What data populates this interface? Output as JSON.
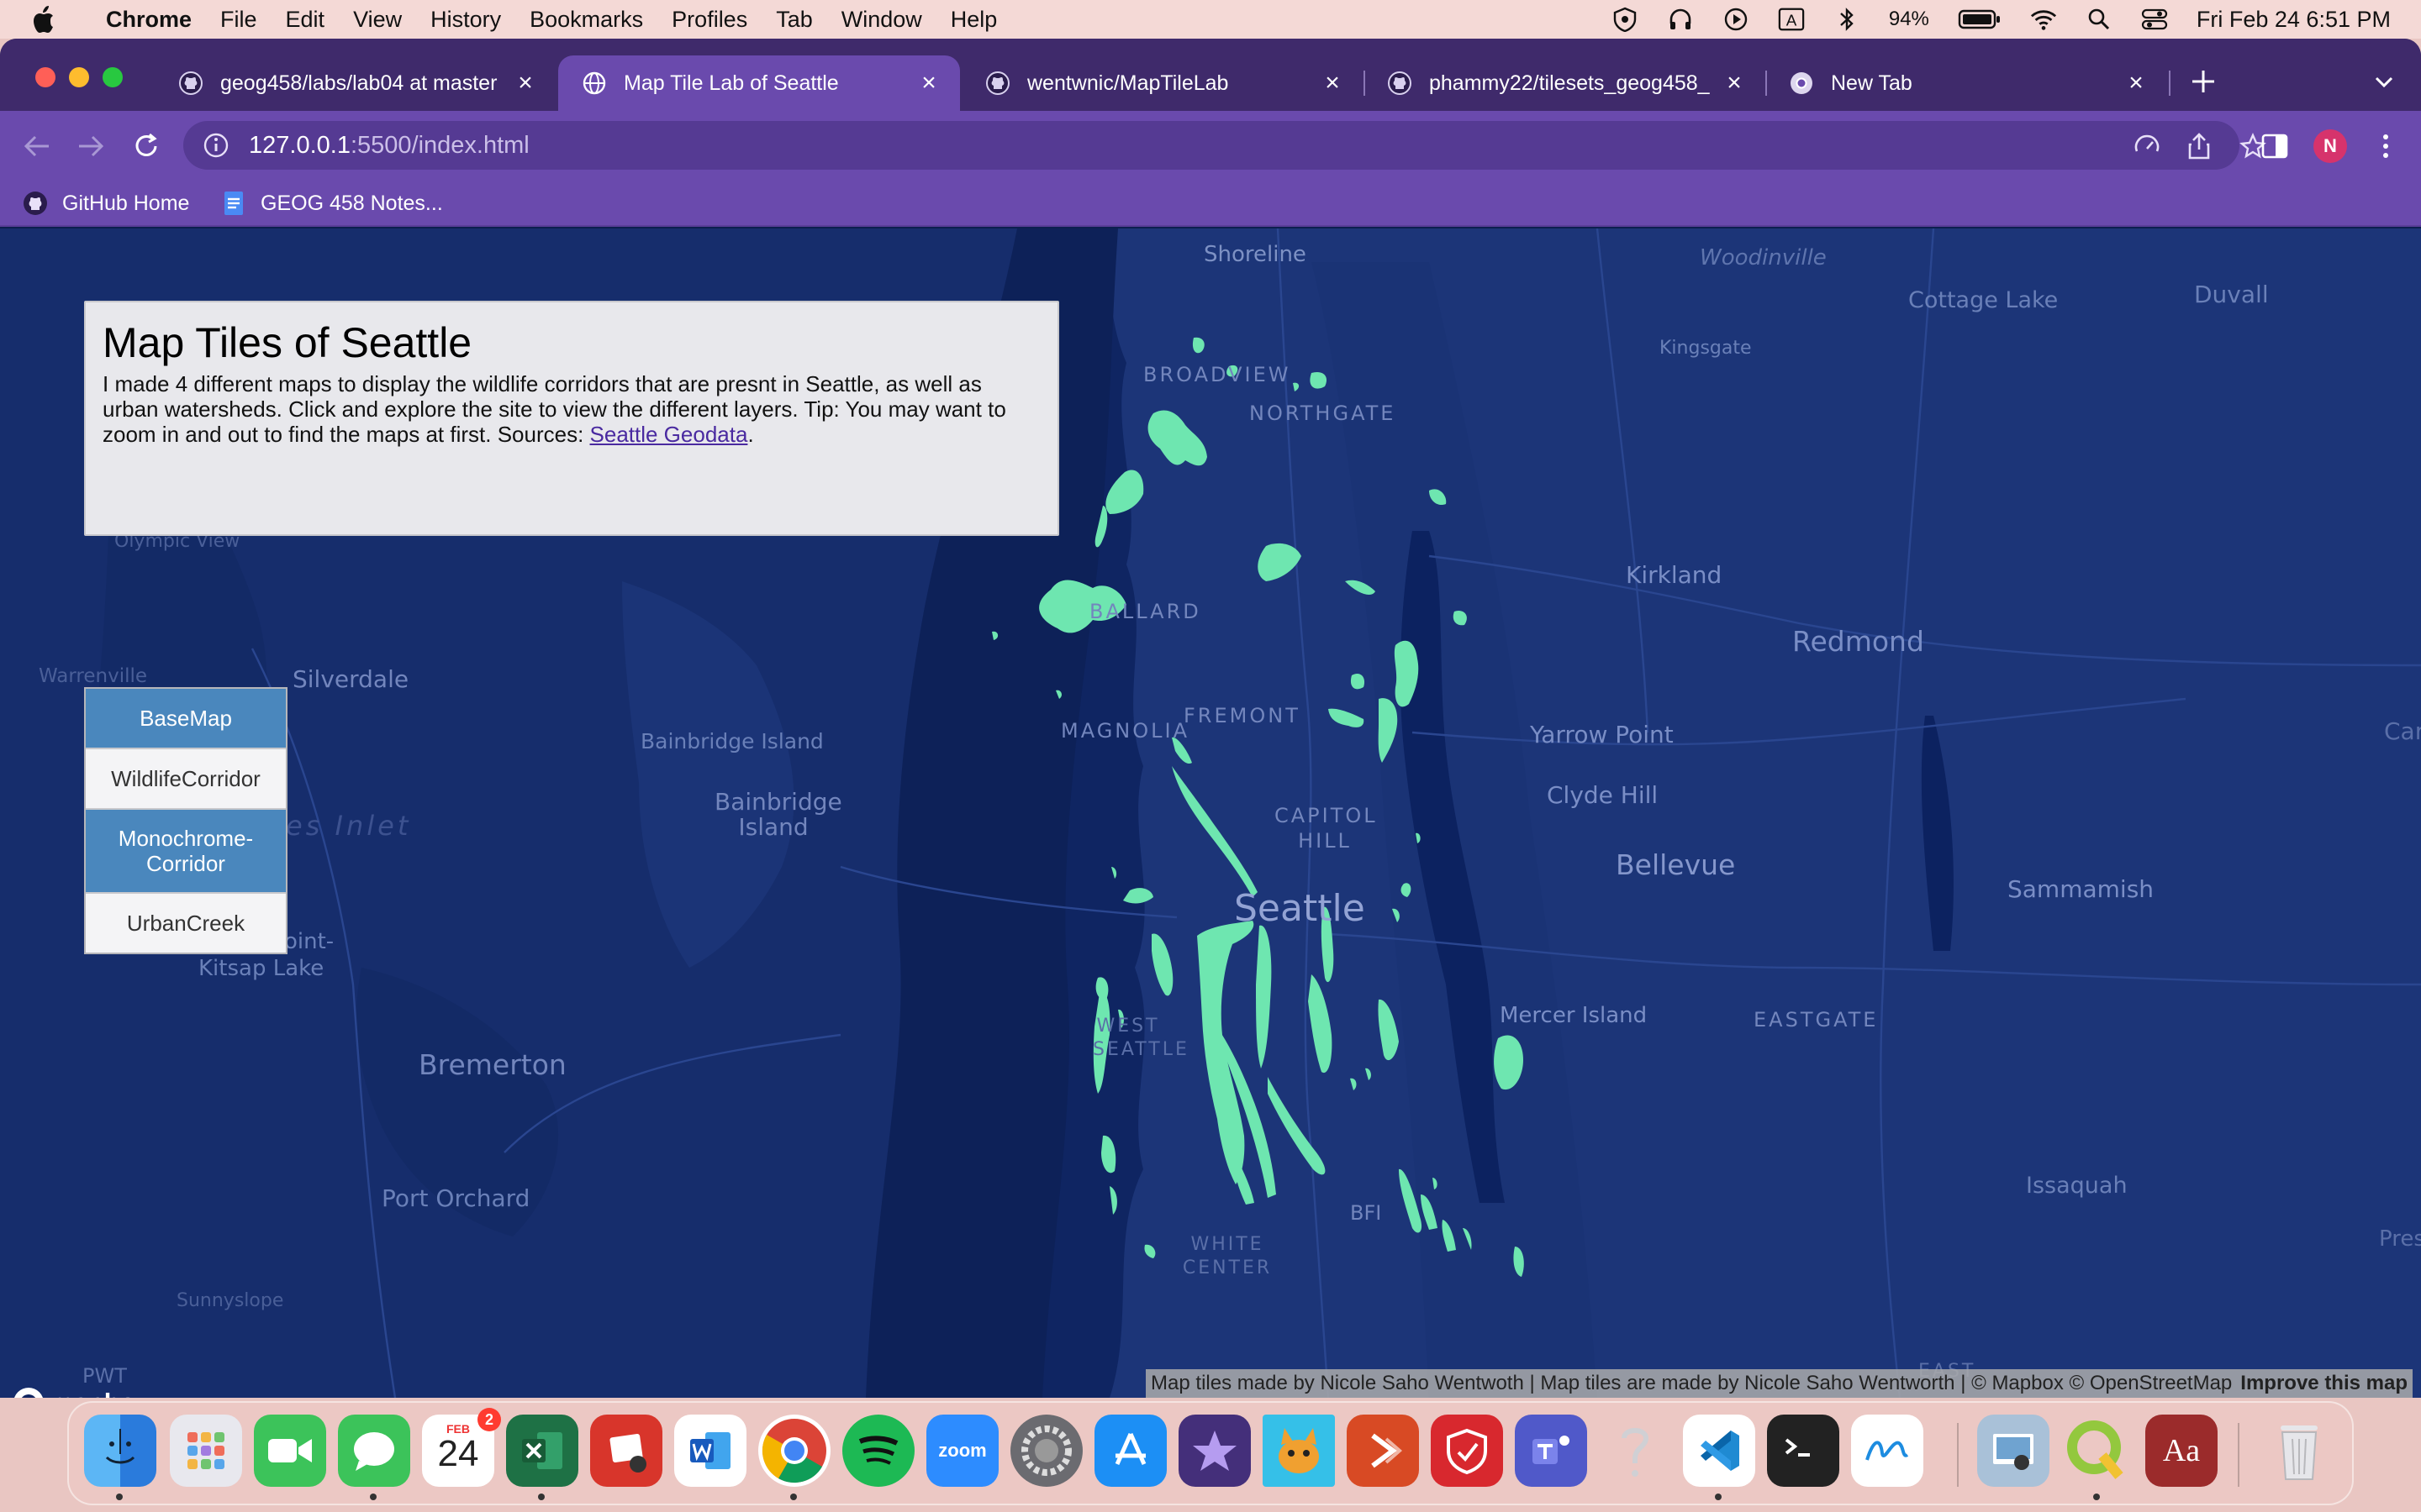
{
  "menubar": {
    "app_name": "Chrome",
    "menus": [
      "File",
      "Edit",
      "View",
      "History",
      "Bookmarks",
      "Profiles",
      "Tab",
      "Window",
      "Help"
    ],
    "battery": "94%",
    "input_mode": "A",
    "clock": "Fri Feb 24  6:51 PM"
  },
  "browser": {
    "tabs": [
      {
        "label": "geog458/labs/lab04 at master",
        "icon": "github-icon",
        "active": false
      },
      {
        "label": "Map Tile Lab of Seattle",
        "icon": "globe-icon",
        "active": true
      },
      {
        "label": "wentwnic/MapTileLab",
        "icon": "github-icon",
        "active": false
      },
      {
        "label": "phammy22/tilesets_geog458_",
        "icon": "github-icon",
        "active": false
      },
      {
        "label": "New Tab",
        "icon": "chrome-icon",
        "active": false
      }
    ],
    "url_host": "127.0.0.1",
    "url_path": ":5500/index.html",
    "profile_initial": "N",
    "bookmarks": [
      {
        "label": "GitHub Home",
        "icon": "github-icon"
      },
      {
        "label": "GEOG 458 Notes...",
        "icon": "docs-icon"
      }
    ]
  },
  "page": {
    "title": "Map Tiles of Seattle",
    "description": "I made 4 different maps to display the wildlife corridors that are presnt in Seattle, as well as urban watersheds. Click and explore the site to view the different layers. Tip: You may want to zoom in and out to find the maps at first. Sources: ",
    "source_link": "Seattle Geodata",
    "source_suffix": ".",
    "layers": [
      {
        "label": "BaseMap",
        "active": true
      },
      {
        "label": "WildlifeCorridor",
        "active": false
      },
      {
        "label": "Monochrome-Corridor",
        "active": true
      },
      {
        "label": "UrbanCreek",
        "active": false
      }
    ],
    "mapbox_logo": "mapbox",
    "attribution": "Map tiles made by Nicole Saho Wentwoth | Map tiles are made by Nicole Saho Wentworth | © Mapbox © OpenStreetMap",
    "improve_link": "Improve this map"
  },
  "map_labels": {
    "shoreline": "Shoreline",
    "woodinville": "Woodinville",
    "cottage_lake": "Cottage Lake",
    "duvall": "Duvall",
    "kingsgate": "Kingsgate",
    "broadview": "BROADVIEW",
    "northgate": "NORTHGATE",
    "olympic_view": "Olympic View",
    "kirkland": "Kirkland",
    "redmond": "Redmond",
    "ballard": "BALLARD",
    "warrenville": "Warrenville",
    "silverdale": "Silverdale",
    "magnolia": "MAGNOLIA",
    "fremont": "FREMONT",
    "bainbridge_island_1": "Bainbridge Island",
    "yarrow_point": "Yarrow Point",
    "bainbridge_island_2": "Bainbridge Island",
    "clyde_hill": "Clyde Hill",
    "capitol_hill": "CAPITOL HILL",
    "inlet": "es Inlet",
    "bellevue": "Bellevue",
    "seattle": "Seattle",
    "sammamish": "Sammamish",
    "point": "oint-",
    "kitsap_lake": "Kitsap Lake",
    "mercer_island": "Mercer Island",
    "eastgate": "EASTGATE",
    "west_seattle": "WEST SEATTLE",
    "bremerton": "Bremerton",
    "port_orchard": "Port Orchard",
    "issaquah": "Issaquah",
    "bfi": "BFI",
    "white_center": "WHITE CENTER",
    "preston": "Presto",
    "sunnyslope": "Sunnyslope",
    "pwt": "PWT",
    "east": "EAST",
    "car": "Car"
  },
  "dock": {
    "apps": [
      "finder",
      "launchpad",
      "facetime",
      "messages",
      "calendar",
      "excel",
      "photo-booth",
      "word",
      "chrome",
      "spotify",
      "zoom",
      "system-settings",
      "app-store",
      "imovie",
      "cat-app",
      "remote-desktop",
      "security",
      "teams",
      "help",
      "vscode",
      "terminal",
      "freeform",
      "preview",
      "qgis",
      "dictionary",
      "trash"
    ],
    "calendar_month": "FEB",
    "calendar_day": "24",
    "calendar_badge": "2",
    "zoom_label": "zoom",
    "dictionary_label": "Aa"
  }
}
